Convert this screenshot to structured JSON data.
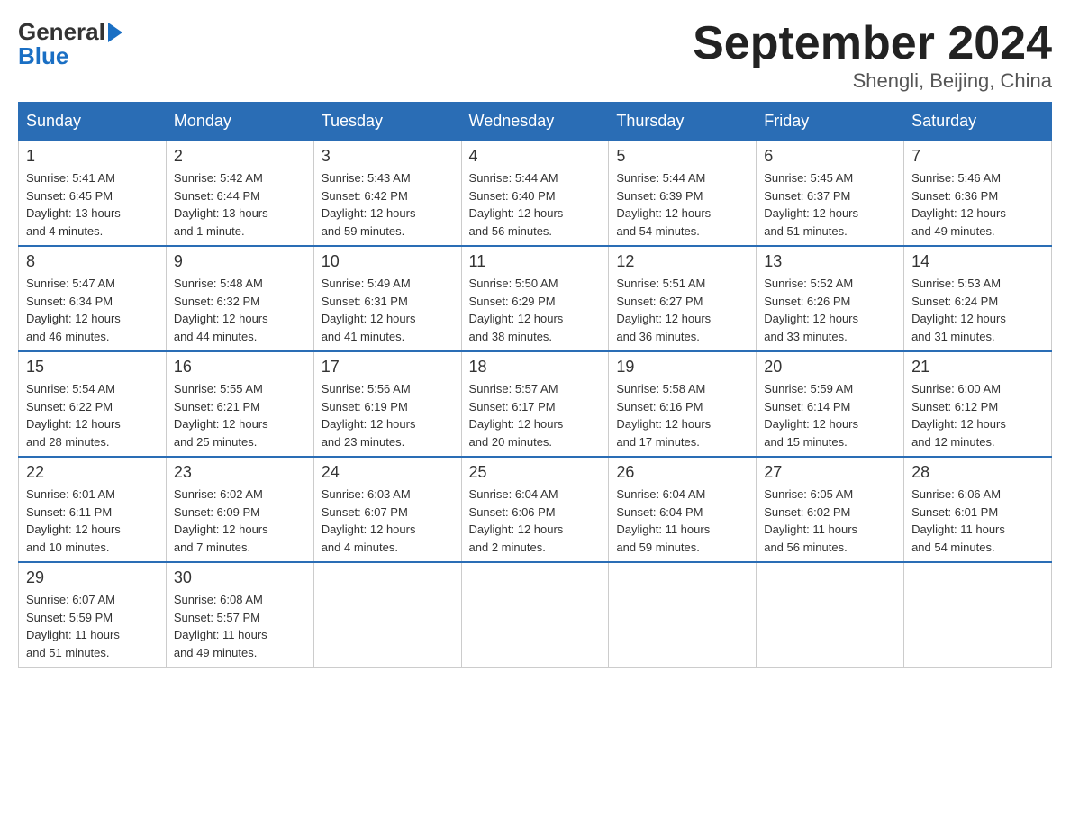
{
  "logo": {
    "line1": "General",
    "arrow": "▶",
    "line2": "Blue"
  },
  "title": "September 2024",
  "location": "Shengli, Beijing, China",
  "days_of_week": [
    "Sunday",
    "Monday",
    "Tuesday",
    "Wednesday",
    "Thursday",
    "Friday",
    "Saturday"
  ],
  "weeks": [
    [
      {
        "day": "1",
        "sunrise": "5:41 AM",
        "sunset": "6:45 PM",
        "daylight": "13 hours and 4 minutes."
      },
      {
        "day": "2",
        "sunrise": "5:42 AM",
        "sunset": "6:44 PM",
        "daylight": "13 hours and 1 minute."
      },
      {
        "day": "3",
        "sunrise": "5:43 AM",
        "sunset": "6:42 PM",
        "daylight": "12 hours and 59 minutes."
      },
      {
        "day": "4",
        "sunrise": "5:44 AM",
        "sunset": "6:40 PM",
        "daylight": "12 hours and 56 minutes."
      },
      {
        "day": "5",
        "sunrise": "5:44 AM",
        "sunset": "6:39 PM",
        "daylight": "12 hours and 54 minutes."
      },
      {
        "day": "6",
        "sunrise": "5:45 AM",
        "sunset": "6:37 PM",
        "daylight": "12 hours and 51 minutes."
      },
      {
        "day": "7",
        "sunrise": "5:46 AM",
        "sunset": "6:36 PM",
        "daylight": "12 hours and 49 minutes."
      }
    ],
    [
      {
        "day": "8",
        "sunrise": "5:47 AM",
        "sunset": "6:34 PM",
        "daylight": "12 hours and 46 minutes."
      },
      {
        "day": "9",
        "sunrise": "5:48 AM",
        "sunset": "6:32 PM",
        "daylight": "12 hours and 44 minutes."
      },
      {
        "day": "10",
        "sunrise": "5:49 AM",
        "sunset": "6:31 PM",
        "daylight": "12 hours and 41 minutes."
      },
      {
        "day": "11",
        "sunrise": "5:50 AM",
        "sunset": "6:29 PM",
        "daylight": "12 hours and 38 minutes."
      },
      {
        "day": "12",
        "sunrise": "5:51 AM",
        "sunset": "6:27 PM",
        "daylight": "12 hours and 36 minutes."
      },
      {
        "day": "13",
        "sunrise": "5:52 AM",
        "sunset": "6:26 PM",
        "daylight": "12 hours and 33 minutes."
      },
      {
        "day": "14",
        "sunrise": "5:53 AM",
        "sunset": "6:24 PM",
        "daylight": "12 hours and 31 minutes."
      }
    ],
    [
      {
        "day": "15",
        "sunrise": "5:54 AM",
        "sunset": "6:22 PM",
        "daylight": "12 hours and 28 minutes."
      },
      {
        "day": "16",
        "sunrise": "5:55 AM",
        "sunset": "6:21 PM",
        "daylight": "12 hours and 25 minutes."
      },
      {
        "day": "17",
        "sunrise": "5:56 AM",
        "sunset": "6:19 PM",
        "daylight": "12 hours and 23 minutes."
      },
      {
        "day": "18",
        "sunrise": "5:57 AM",
        "sunset": "6:17 PM",
        "daylight": "12 hours and 20 minutes."
      },
      {
        "day": "19",
        "sunrise": "5:58 AM",
        "sunset": "6:16 PM",
        "daylight": "12 hours and 17 minutes."
      },
      {
        "day": "20",
        "sunrise": "5:59 AM",
        "sunset": "6:14 PM",
        "daylight": "12 hours and 15 minutes."
      },
      {
        "day": "21",
        "sunrise": "6:00 AM",
        "sunset": "6:12 PM",
        "daylight": "12 hours and 12 minutes."
      }
    ],
    [
      {
        "day": "22",
        "sunrise": "6:01 AM",
        "sunset": "6:11 PM",
        "daylight": "12 hours and 10 minutes."
      },
      {
        "day": "23",
        "sunrise": "6:02 AM",
        "sunset": "6:09 PM",
        "daylight": "12 hours and 7 minutes."
      },
      {
        "day": "24",
        "sunrise": "6:03 AM",
        "sunset": "6:07 PM",
        "daylight": "12 hours and 4 minutes."
      },
      {
        "day": "25",
        "sunrise": "6:04 AM",
        "sunset": "6:06 PM",
        "daylight": "12 hours and 2 minutes."
      },
      {
        "day": "26",
        "sunrise": "6:04 AM",
        "sunset": "6:04 PM",
        "daylight": "11 hours and 59 minutes."
      },
      {
        "day": "27",
        "sunrise": "6:05 AM",
        "sunset": "6:02 PM",
        "daylight": "11 hours and 56 minutes."
      },
      {
        "day": "28",
        "sunrise": "6:06 AM",
        "sunset": "6:01 PM",
        "daylight": "11 hours and 54 minutes."
      }
    ],
    [
      {
        "day": "29",
        "sunrise": "6:07 AM",
        "sunset": "5:59 PM",
        "daylight": "11 hours and 51 minutes."
      },
      {
        "day": "30",
        "sunrise": "6:08 AM",
        "sunset": "5:57 PM",
        "daylight": "11 hours and 49 minutes."
      },
      null,
      null,
      null,
      null,
      null
    ]
  ]
}
